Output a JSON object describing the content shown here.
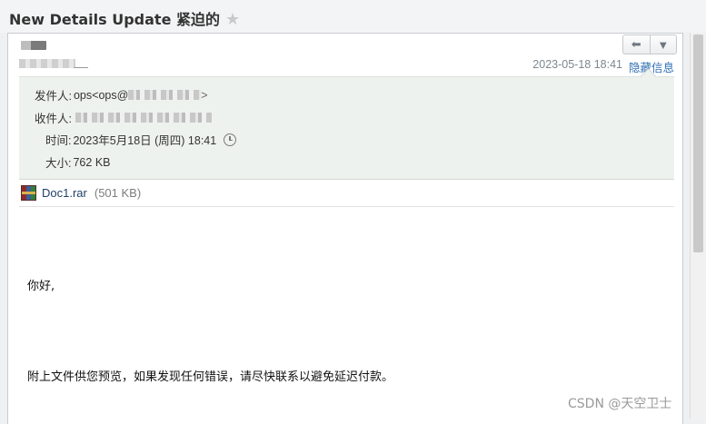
{
  "subject": {
    "title": "New Details Update 紧迫的",
    "star_icon": "star-icon"
  },
  "header": {
    "date": "2023-05-18 18:41",
    "hide_label": "隐藏信息",
    "reply_icon": "reply-icon",
    "more_icon": "chevron-down-icon"
  },
  "details": {
    "from_label": "发件人:",
    "from_value": "ops<ops@",
    "from_close": ">",
    "to_label": "收件人:",
    "time_label": "时间:",
    "time_value": "2023年5月18日 (周四) 18:41",
    "size_label": "大小:",
    "size_value": "762 KB"
  },
  "attachment": {
    "name": "Doc1.rar",
    "size": "(501 KB)",
    "icon": "rar-file-icon"
  },
  "body": {
    "greeting": "你好,",
    "paragraph": "附上文件供您预览，如果发现任何错误，请尽快联系以避免延迟付款。"
  },
  "watermark": "CSDN @天空卫士"
}
